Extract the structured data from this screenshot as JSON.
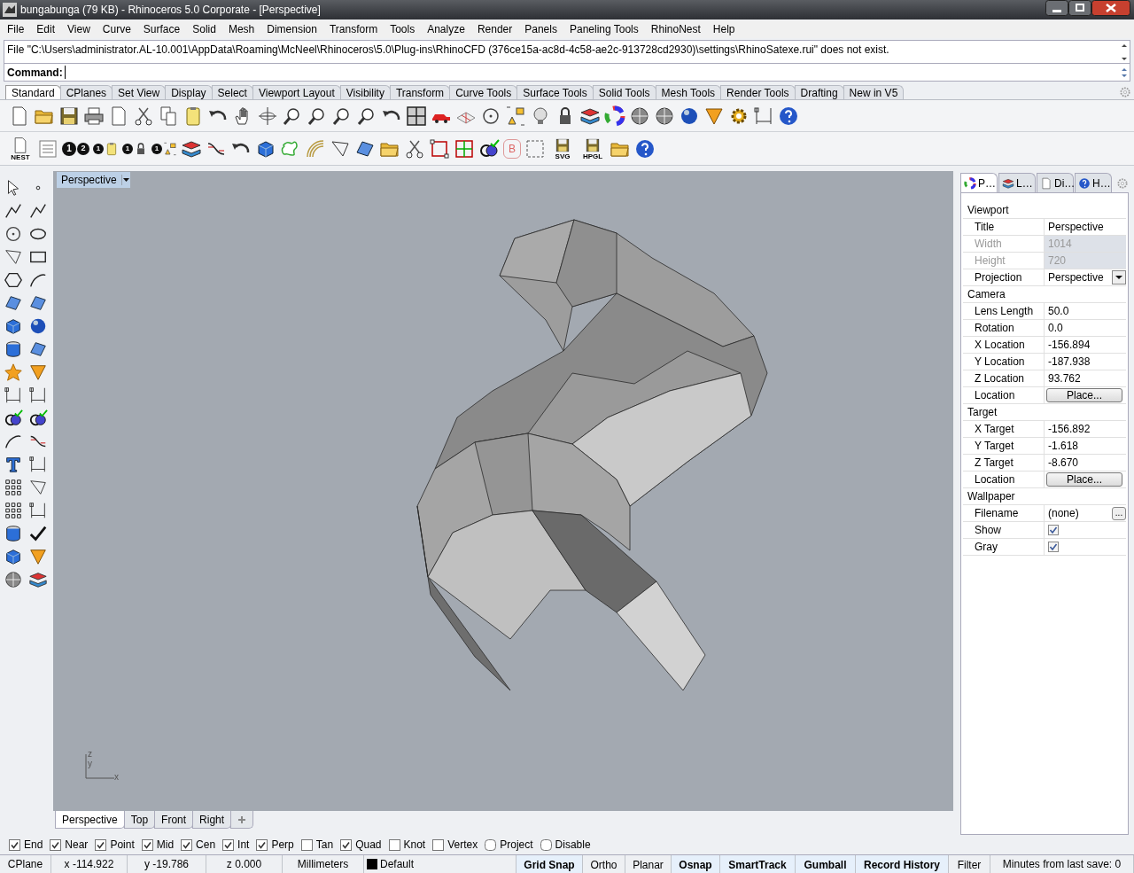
{
  "window": {
    "title": "bungabunga (79 KB) - Rhinoceros  5.0 Corporate - [Perspective]"
  },
  "menu": [
    "File",
    "Edit",
    "View",
    "Curve",
    "Surface",
    "Solid",
    "Mesh",
    "Dimension",
    "Transform",
    "Tools",
    "Analyze",
    "Render",
    "Panels",
    "Paneling Tools",
    "RhinoNest",
    "Help"
  ],
  "command_history": "File \"C:\\Users\\administrator.AL-10.001\\AppData\\Roaming\\McNeel\\Rhinoceros\\5.0\\Plug-ins\\RhinoCFD (376ce15a-ac8d-4c58-ae2c-913728cd2930)\\settings\\RhinoSatexe.rui\" does not exist.",
  "command_label": "Command:",
  "toolbar_tabs": [
    {
      "label": "Standard",
      "selected": true
    },
    {
      "label": "CPlanes",
      "selected": false
    },
    {
      "label": "Set View",
      "selected": false
    },
    {
      "label": "Display",
      "selected": false
    },
    {
      "label": "Select",
      "selected": false
    },
    {
      "label": "Viewport Layout",
      "selected": false
    },
    {
      "label": "Visibility",
      "selected": false
    },
    {
      "label": "Transform",
      "selected": false
    },
    {
      "label": "Curve Tools",
      "selected": false
    },
    {
      "label": "Surface Tools",
      "selected": false
    },
    {
      "label": "Solid Tools",
      "selected": false
    },
    {
      "label": "Mesh Tools",
      "selected": false
    },
    {
      "label": "Render Tools",
      "selected": false
    },
    {
      "label": "Drafting",
      "selected": false
    },
    {
      "label": "New in V5",
      "selected": false
    }
  ],
  "toolbar_2_icon_labels": [
    "NEST",
    "1",
    "2",
    "1",
    "1",
    "1",
    "B",
    "SVG",
    "HPGL"
  ],
  "viewport": {
    "title": "Perspective",
    "axis_labels": [
      "z",
      "y",
      "x"
    ]
  },
  "viewport_tabs": [
    {
      "label": "Perspective",
      "selected": true
    },
    {
      "label": "Top",
      "selected": false
    },
    {
      "label": "Front",
      "selected": false
    },
    {
      "label": "Right",
      "selected": false
    }
  ],
  "panel_tabs": [
    {
      "label": "P…",
      "selected": true
    },
    {
      "label": "L…",
      "selected": false
    },
    {
      "label": "Di…",
      "selected": false
    },
    {
      "label": "H…",
      "selected": false
    }
  ],
  "properties": [
    {
      "title": "Viewport",
      "rows": [
        {
          "kind": "text",
          "label": "Title",
          "value": "Perspective",
          "disabled": false
        },
        {
          "kind": "text",
          "label": "Width",
          "value": "1014",
          "disabled": true
        },
        {
          "kind": "text",
          "label": "Height",
          "value": "720",
          "disabled": true
        },
        {
          "kind": "dropdown",
          "label": "Projection",
          "value": "Perspective",
          "disabled": false
        }
      ]
    },
    {
      "title": "Camera",
      "rows": [
        {
          "kind": "text",
          "label": "Lens Length",
          "value": "50.0",
          "disabled": false
        },
        {
          "kind": "text",
          "label": "Rotation",
          "value": "0.0",
          "disabled": false
        },
        {
          "kind": "text",
          "label": "X Location",
          "value": "-156.894",
          "disabled": false
        },
        {
          "kind": "text",
          "label": "Y Location",
          "value": "-187.938",
          "disabled": false
        },
        {
          "kind": "text",
          "label": "Z Location",
          "value": "93.762",
          "disabled": false
        },
        {
          "kind": "button",
          "label": "Location",
          "value": "Place...",
          "disabled": false
        }
      ]
    },
    {
      "title": "Target",
      "rows": [
        {
          "kind": "text",
          "label": "X Target",
          "value": "-156.892",
          "disabled": false
        },
        {
          "kind": "text",
          "label": "Y Target",
          "value": "-1.618",
          "disabled": false
        },
        {
          "kind": "text",
          "label": "Z Target",
          "value": "-8.670",
          "disabled": false
        },
        {
          "kind": "button",
          "label": "Location",
          "value": "Place...",
          "disabled": false
        }
      ]
    },
    {
      "title": "Wallpaper",
      "rows": [
        {
          "kind": "file",
          "label": "Filename",
          "value": "(none)",
          "button": "...",
          "disabled": false
        },
        {
          "kind": "checkbox",
          "label": "Show",
          "checked": true,
          "disabled": false
        },
        {
          "kind": "checkbox",
          "label": "Gray",
          "checked": true,
          "disabled": false
        }
      ]
    }
  ],
  "osnaps": [
    {
      "label": "End",
      "checked": true
    },
    {
      "label": "Near",
      "checked": true
    },
    {
      "label": "Point",
      "checked": true
    },
    {
      "label": "Mid",
      "checked": true
    },
    {
      "label": "Cen",
      "checked": true
    },
    {
      "label": "Int",
      "checked": true
    },
    {
      "label": "Perp",
      "checked": true
    },
    {
      "label": "Tan",
      "checked": false
    },
    {
      "label": "Quad",
      "checked": true
    },
    {
      "label": "Knot",
      "checked": false
    },
    {
      "label": "Vertex",
      "checked": false
    },
    {
      "label": "Project",
      "checked": false
    },
    {
      "label": "Disable",
      "checked": false
    }
  ],
  "status_bar": [
    {
      "kind": "field",
      "text": "CPlane"
    },
    {
      "kind": "field",
      "text": "x -114.922"
    },
    {
      "kind": "field",
      "text": "y -19.786"
    },
    {
      "kind": "field",
      "text": "z 0.000"
    },
    {
      "kind": "field",
      "text": "Millimeters"
    },
    {
      "kind": "layer",
      "text": "Default",
      "color": "#000000"
    },
    {
      "kind": "toggle",
      "text": "Grid Snap",
      "on": true
    },
    {
      "kind": "toggle",
      "text": "Ortho",
      "on": false
    },
    {
      "kind": "toggle",
      "text": "Planar",
      "on": false
    },
    {
      "kind": "toggle",
      "text": "Osnap",
      "on": true
    },
    {
      "kind": "toggle",
      "text": "SmartTrack",
      "on": true
    },
    {
      "kind": "toggle",
      "text": "Gumball",
      "on": true
    },
    {
      "kind": "toggle",
      "text": "Record History",
      "on": true
    },
    {
      "kind": "toggle",
      "text": "Filter",
      "on": false
    },
    {
      "kind": "field",
      "text": "Minutes from last save: 0"
    }
  ]
}
